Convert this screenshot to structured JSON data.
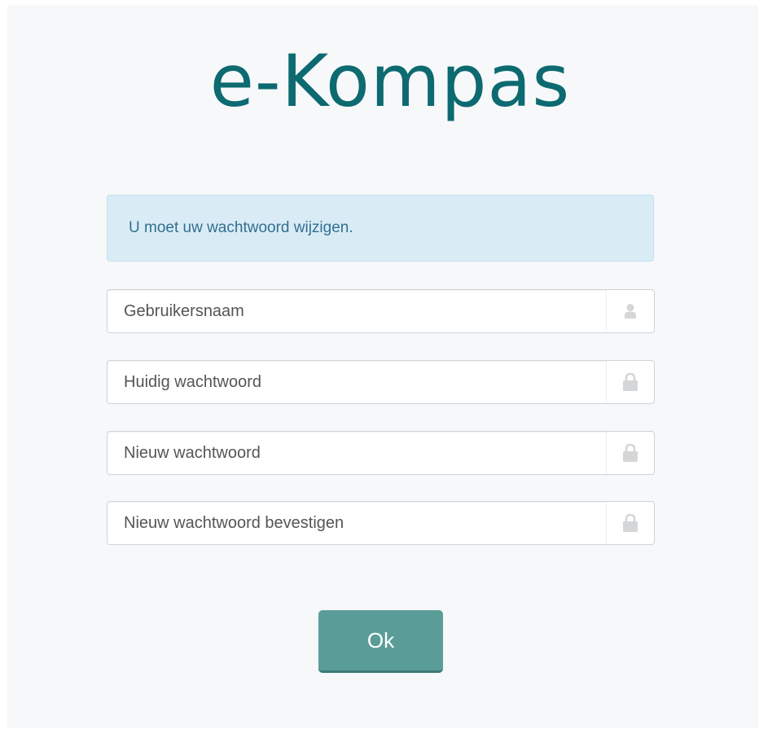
{
  "app": {
    "logo_text": "e-Kompas"
  },
  "alert": {
    "message": "U moet uw wachtwoord wijzigen."
  },
  "form": {
    "fields": [
      {
        "placeholder": "Gebruikersnaam",
        "icon": "user-icon"
      },
      {
        "placeholder": "Huidig wachtwoord",
        "icon": "lock-icon"
      },
      {
        "placeholder": "Nieuw wachtwoord",
        "icon": "lock-icon"
      },
      {
        "placeholder": "Nieuw wachtwoord bevestigen",
        "icon": "lock-icon"
      }
    ],
    "submit_label": "Ok"
  },
  "colors": {
    "brand": "#0c6a70",
    "alert_bg": "#d9ecf6",
    "alert_text": "#31708f",
    "button": "#5a9d98",
    "icon": "#d4d6d8"
  }
}
